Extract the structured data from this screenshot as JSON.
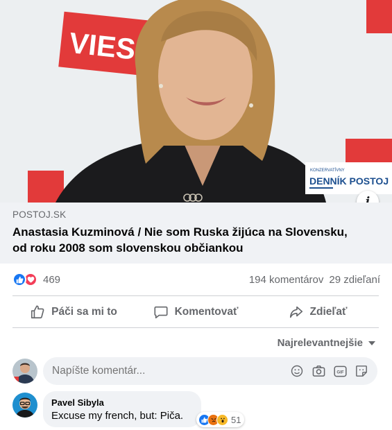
{
  "post": {
    "image_alt": "Anastasia Kuzminová",
    "image_overlays": {
      "sponsor_banner_left": "VIESS",
      "logo_tagline": "KONZERVATÍVNY",
      "logo_name": "DENNÍK POSTOJ"
    },
    "info_icon_glyph": "i",
    "link": {
      "domain": "POSTOJ.SK",
      "title_line1": "Anastasia Kuzminová / Nie som Ruska žijúca na Slovensku,",
      "title_line2": "od roku 2008 som slovenskou občiankou"
    },
    "stats": {
      "reaction_icons": [
        "like-icon",
        "love-icon"
      ],
      "reaction_count": "469",
      "comments": "194 komentárov",
      "shares": "29 zdieľaní"
    },
    "actions": [
      {
        "label": "Páči sa mi to",
        "icon": "thumbs-up-icon"
      },
      {
        "label": "Komentovať",
        "icon": "speech-bubble-icon"
      },
      {
        "label": "Zdieľať",
        "icon": "share-arrow-icon"
      }
    ]
  },
  "comments": {
    "sort_label": "Najrelevantnejšie",
    "composer": {
      "placeholder": "Napíšte komentár...",
      "icons": [
        "emoji-icon",
        "camera-icon",
        "gif-icon",
        "sticker-icon"
      ]
    },
    "items": [
      {
        "author": "Pavel Sibyla",
        "text": "Excuse my french, but: Piča.",
        "reaction_icons": [
          "like-icon",
          "angry-icon",
          "wow-icon"
        ],
        "reaction_count": "51"
      }
    ]
  },
  "colors": {
    "facebook_blue": "#1877f2",
    "love_red": "#f33e58",
    "secondary_text": "#65676b",
    "surface_gray": "#f0f2f5",
    "divider": "#ced0d4",
    "banner_red": "#e33b3b",
    "logo_blue": "#1c4f8f"
  }
}
